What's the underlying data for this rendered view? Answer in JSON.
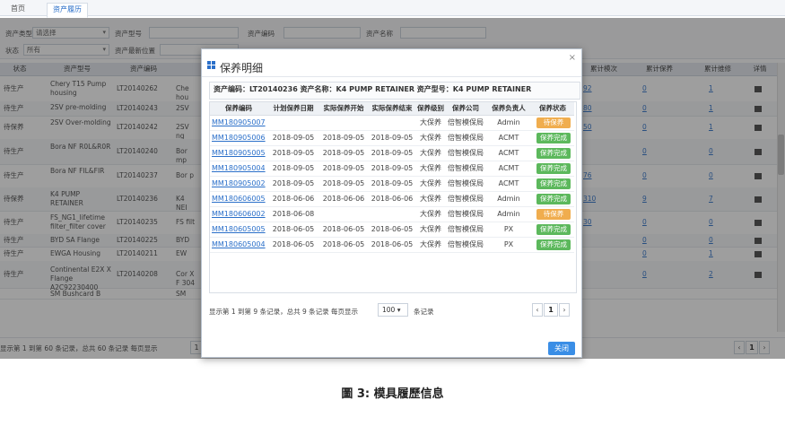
{
  "top_tabs": [
    "首页",
    "资产履历"
  ],
  "search": {
    "type_label": "资产类型",
    "type_value": "请选择",
    "model_label": "资产型号",
    "code_label": "资产编码",
    "name_label": "资产名称",
    "status_label": "状态",
    "status_value": "所有",
    "location_label": "资产最新位置"
  },
  "grid": {
    "headers": [
      "状态",
      "资产型号",
      "资产编码",
      "累计模次",
      "累计保养",
      "累计维修",
      "详情"
    ],
    "rows": [
      {
        "status": "待生产",
        "model": "Chery T15 Pump housing",
        "code": "LT20140262",
        "trunc": "Che hou",
        "cnt": "92",
        "maint": "0",
        "repair": "1"
      },
      {
        "status": "待生产",
        "model": "2SV pre-molding",
        "code": "LT20140243",
        "trunc": "2SV",
        "cnt": "80",
        "maint": "0",
        "repair": "1"
      },
      {
        "status": "待保养",
        "model": "2SV Over-molding",
        "code": "LT20140242",
        "trunc": "2SV ng",
        "cnt": "50",
        "maint": "0",
        "repair": "1"
      },
      {
        "status": "待生产",
        "model": "Bora NF R0L&amp;R0R",
        "code": "LT20140240",
        "trunc": "Bor mp",
        "cnt": "",
        "maint": "0",
        "repair": "0"
      },
      {
        "status": "待生产",
        "model": "Bora NF FIL&amp;FIR",
        "code": "LT20140237",
        "trunc": "Bor p",
        "cnt": "76",
        "maint": "0",
        "repair": "0"
      },
      {
        "status": "待保养",
        "model": "K4 PUMP RETAINER",
        "code": "LT20140236",
        "trunc": "K4 NEI",
        "cnt": "310",
        "maint": "9",
        "repair": "7"
      },
      {
        "status": "待生产",
        "model": "FS_NG1_lifetime filter_filter cover",
        "code": "LT20140235",
        "trunc": "FS filt",
        "cnt": "30",
        "maint": "0",
        "repair": "0"
      },
      {
        "status": "待生产",
        "model": "BYD SA Flange",
        "code": "LT20140225",
        "trunc": "BYD",
        "cnt": "",
        "maint": "0",
        "repair": "0"
      },
      {
        "status": "待生产",
        "model": "EWGA Housing",
        "code": "LT20140211",
        "trunc": "EW",
        "cnt": "",
        "maint": "0",
        "repair": "1"
      },
      {
        "status": "待生产",
        "model": "Continental E2X X Flange A2C92230400",
        "code": "LT20140208",
        "trunc": "Cor X F 304",
        "cnt": "",
        "maint": "0",
        "repair": "2"
      },
      {
        "status": "",
        "model": "SM Bushcard B",
        "code": "",
        "trunc": "SM",
        "cnt": "",
        "maint": "",
        "repair": ""
      }
    ],
    "footer_text": "显示第 1 到第 60 条记录，总共 60 条记录 每页显示",
    "footer_size": "1",
    "page_num": "1"
  },
  "modal": {
    "title": "保养明细",
    "info": "资产编码：LT20140236   资产名称：K4 PUMP RETAINER   资产型号：K4 PUMP RETAINER",
    "headers": [
      "保养编码",
      "计划保养日期",
      "实际保养开始",
      "实际保养结束",
      "保养级别",
      "保养公司",
      "保养负责人",
      "保养状态"
    ],
    "rows": [
      {
        "code": "MM180905007",
        "plan": "",
        "start": "",
        "end": "",
        "level": "大保养",
        "company": "倍智模保局",
        "owner": "Admin",
        "state": "待保养",
        "state_color": "#f0ad4e"
      },
      {
        "code": "MM180905006",
        "plan": "2018-09-05",
        "start": "2018-09-05",
        "end": "2018-09-05",
        "level": "大保养",
        "company": "倍智模保局",
        "owner": "ACMT",
        "state": "保养完成",
        "state_color": "#5cb85c"
      },
      {
        "code": "MM180905005",
        "plan": "2018-09-05",
        "start": "2018-09-05",
        "end": "2018-09-05",
        "level": "大保养",
        "company": "倍智模保局",
        "owner": "ACMT",
        "state": "保养完成",
        "state_color": "#5cb85c"
      },
      {
        "code": "MM180905004",
        "plan": "2018-09-05",
        "start": "2018-09-05",
        "end": "2018-09-05",
        "level": "大保养",
        "company": "倍智模保局",
        "owner": "ACMT",
        "state": "保养完成",
        "state_color": "#5cb85c"
      },
      {
        "code": "MM180905002",
        "plan": "2018-09-05",
        "start": "2018-09-05",
        "end": "2018-09-05",
        "level": "大保养",
        "company": "倍智模保局",
        "owner": "ACMT",
        "state": "保养完成",
        "state_color": "#5cb85c"
      },
      {
        "code": "MM180606005",
        "plan": "2018-06-06",
        "start": "2018-06-06",
        "end": "2018-06-06",
        "level": "大保养",
        "company": "倍智模保局",
        "owner": "Admin",
        "state": "保养完成",
        "state_color": "#5cb85c"
      },
      {
        "code": "MM180606002",
        "plan": "2018-06-08",
        "start": "",
        "end": "",
        "level": "大保养",
        "company": "倍智模保局",
        "owner": "Admin",
        "state": "待保养",
        "state_color": "#f0ad4e"
      },
      {
        "code": "MM180605005",
        "plan": "2018-06-05",
        "start": "2018-06-05",
        "end": "2018-06-05",
        "level": "大保养",
        "company": "倍智模保局",
        "owner": "PX",
        "state": "保养完成",
        "state_color": "#5cb85c"
      },
      {
        "code": "MM180605004",
        "plan": "2018-06-05",
        "start": "2018-06-05",
        "end": "2018-06-05",
        "level": "大保养",
        "company": "倍智模保局",
        "owner": "PX",
        "state": "保养完成",
        "state_color": "#5cb85c"
      }
    ],
    "pager_text": "显示第 1 到第 9 条记录，总共 9 条记录 每页显示",
    "pager_size": "100",
    "pager_unit": "条记录",
    "page_num": "1",
    "close_label": "关闭"
  },
  "caption": "圖 3: 模具履歷信息"
}
